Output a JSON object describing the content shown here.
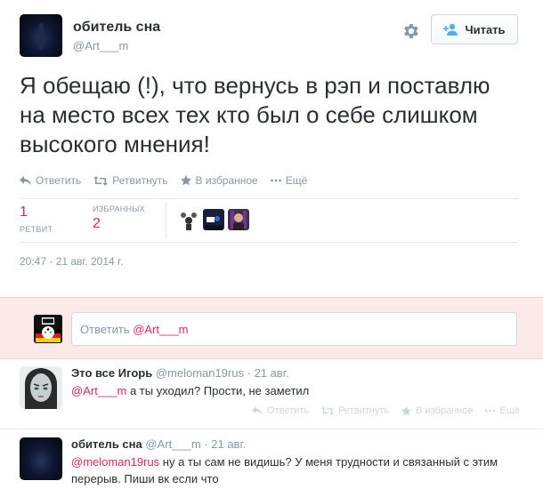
{
  "header": {
    "fullname": "обитель сна",
    "username": "@Art___m",
    "follow_label": "Читать"
  },
  "tweet": {
    "text": "Я обещаю (!), что вернусь в рэп и поставлю на место всех тех кто был о себе слишком высокого мнения!",
    "actions": {
      "reply": "Ответить",
      "retweet": "Ретвитнуть",
      "favorite": "В избранное",
      "more": "Ещё"
    },
    "stats": {
      "retweets_count": "1",
      "retweets_label": "РЕТВИТ",
      "favorites_label": "ИЗБРАННЫХ",
      "favorites_count": "2"
    },
    "timestamp": "20:47 - 21 авг. 2014 г."
  },
  "reply_box": {
    "prefix": "Ответить ",
    "mention": "@Art___m"
  },
  "replies": [
    {
      "name": "Это все Игорь",
      "username": "@meloman19rus",
      "time": "· 21 авг.",
      "mention": "@Art___m",
      "text": " а ты уходил? Прости, не заметил",
      "actions": {
        "reply": "Ответить",
        "retweet": "Ретвитнуть",
        "favorite": "В избранное",
        "more": "Ещё"
      }
    },
    {
      "name": "обитель сна",
      "username": "@Art___m",
      "time": "· 21 авг.",
      "mention": "@meloman19rus",
      "text": " ну а ты сам не видишь? У меня трудности и связанный с этим перерыв. Пиши вк если что"
    }
  ],
  "colors": {
    "accent": "#e0245e",
    "muted": "#8899a6",
    "text": "#292f33",
    "reply_bg": "#fbe9e9"
  },
  "icons": [
    "gear-icon",
    "follow-user-icon",
    "reply-icon",
    "retweet-icon",
    "star-icon",
    "more-icon"
  ]
}
